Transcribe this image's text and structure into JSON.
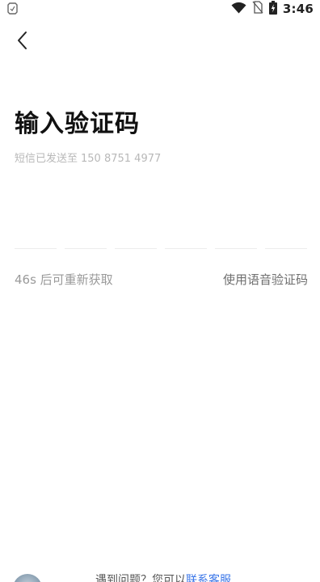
{
  "status_bar": {
    "time": "3:46",
    "icons": [
      "notification-icon",
      "wifi-icon",
      "no-sim-icon",
      "battery-charging-icon"
    ]
  },
  "nav": {
    "back_icon": "chevron-left-icon"
  },
  "title": "输入验证码",
  "sent_info": {
    "label": "短信已发送至",
    "phone": "150 8751 4977"
  },
  "code_inputs": [
    "",
    "",
    "",
    "",
    "",
    ""
  ],
  "resend": {
    "text": "46s 后可重新获取"
  },
  "voice_code": {
    "label": "使用语音验证码"
  },
  "help": {
    "prefix": "遇到问题？您可以",
    "link": "联系客服"
  },
  "colors": {
    "background": "#ffffff",
    "title": "#111111",
    "secondary_text": "#b8b8b8",
    "link": "#3a76e8"
  }
}
